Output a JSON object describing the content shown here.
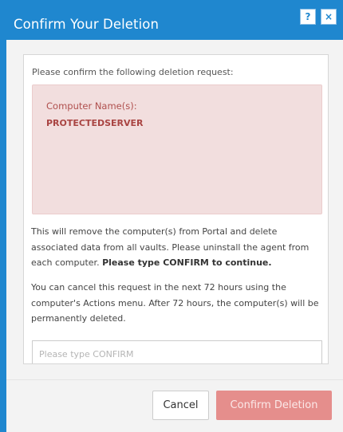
{
  "dialog": {
    "title": "Confirm Your Deletion",
    "help_label": "?",
    "close_label": "×"
  },
  "content": {
    "intro": "Please confirm the following deletion request:",
    "alert": {
      "label": "Computer Name(s):",
      "value": "PROTECTEDSERVER"
    },
    "warning_text": "This will remove the computer(s) from Portal and delete associated data from all vaults. Please uninstall the agent from each computer. ",
    "warning_strong": "Please type CONFIRM to continue.",
    "cancel_note": "You can cancel this request in the next 72 hours using the computer's Actions menu. After 72 hours, the computer(s) will be permanently deleted.",
    "input": {
      "placeholder": "Please type CONFIRM",
      "value": ""
    }
  },
  "footer": {
    "cancel_label": "Cancel",
    "confirm_label": "Confirm Deletion"
  },
  "colors": {
    "titlebar": "#1f87cf",
    "alert_bg": "#f2dede",
    "alert_text": "#a94442",
    "confirm_button": "#e58e8c"
  }
}
